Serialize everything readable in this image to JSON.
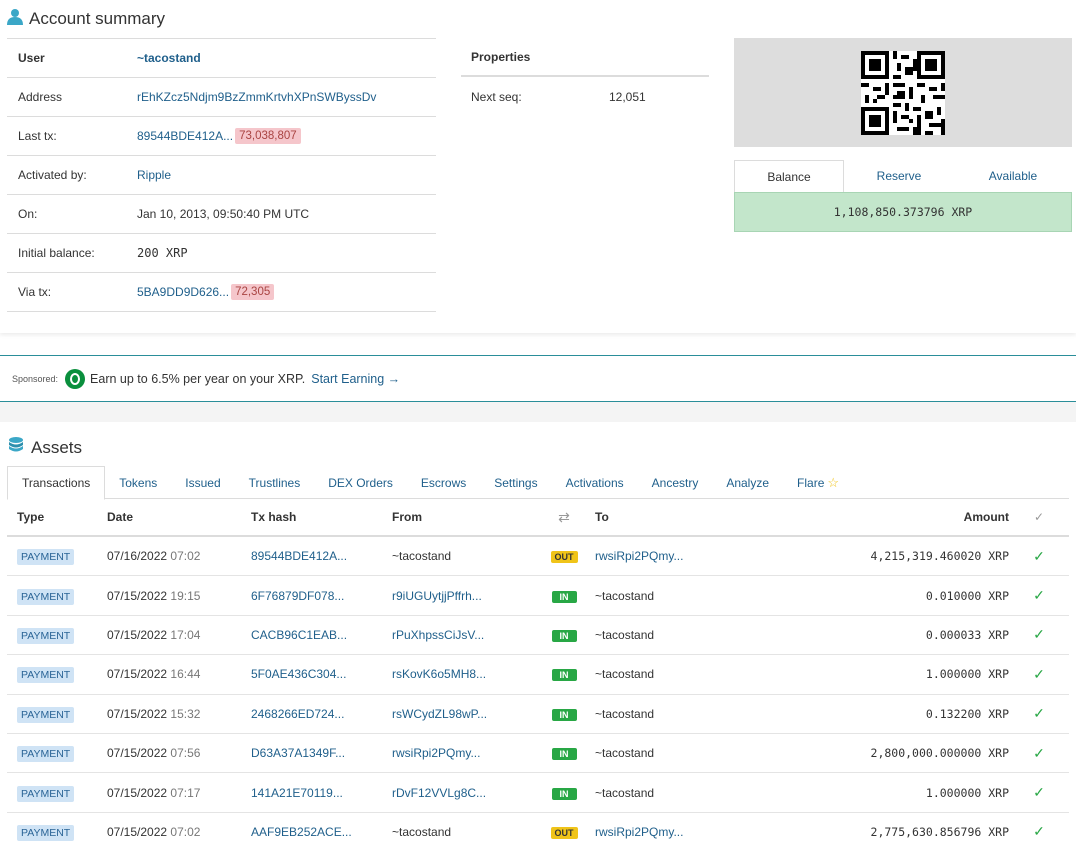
{
  "summary": {
    "title": "Account summary",
    "user_label": "User",
    "user_value": "~tacostand",
    "rows": [
      {
        "label": "Address",
        "value": "rEhKZcz5Ndjm9BzZmmKrtvhXPnSWByssDv",
        "badge": ""
      },
      {
        "label": "Last tx:",
        "value": "89544BDE412A...",
        "badge": "73,038,807"
      },
      {
        "label": "Activated by:",
        "value": "Ripple",
        "badge": ""
      },
      {
        "label": "On:",
        "value": "Jan 10, 2013, 09:50:40 PM UTC",
        "badge": ""
      },
      {
        "label": "Initial balance:",
        "value": "200 XRP",
        "badge": ""
      },
      {
        "label": "Via tx:",
        "value": "5BA9DD9D626...",
        "badge": "72,305"
      }
    ],
    "properties": {
      "header": "Properties",
      "next_seq_label": "Next seq:",
      "next_seq_value": "12,051"
    },
    "balance_tabs": [
      "Balance",
      "Reserve",
      "Available"
    ],
    "balance_value": "1,108,850.373796 XRP"
  },
  "sponsored": {
    "label": "Sponsored:",
    "message": "Earn up to 6.5% per year on your XRP.",
    "cta": "Start Earning →"
  },
  "assets": {
    "title": "Assets",
    "tabs": [
      "Transactions",
      "Tokens",
      "Issued",
      "Trustlines",
      "DEX Orders",
      "Escrows",
      "Settings",
      "Activations",
      "Ancestry",
      "Analyze",
      "Flare"
    ],
    "columns": {
      "type": "Type",
      "date": "Date",
      "hash": "Tx hash",
      "from": "From",
      "to": "To",
      "amount": "Amount"
    },
    "rows": [
      {
        "type": "PAYMENT",
        "date": "07/16/2022",
        "time": "07:02",
        "hash": "89544BDE412A...",
        "from": "~tacostand",
        "dir": "OUT",
        "to": "rwsiRpi2PQmy...",
        "amount": "4,215,319.460020 XRP"
      },
      {
        "type": "PAYMENT",
        "date": "07/15/2022",
        "time": "19:15",
        "hash": "6F76879DF078...",
        "from": "r9iUGUytjjPffrh...",
        "dir": "IN",
        "to": "~tacostand",
        "amount": "0.010000 XRP"
      },
      {
        "type": "PAYMENT",
        "date": "07/15/2022",
        "time": "17:04",
        "hash": "CACB96C1EAB...",
        "from": "rPuXhpssCiJsV...",
        "dir": "IN",
        "to": "~tacostand",
        "amount": "0.000033 XRP"
      },
      {
        "type": "PAYMENT",
        "date": "07/15/2022",
        "time": "16:44",
        "hash": "5F0AE436C304...",
        "from": "rsKovK6o5MH8...",
        "dir": "IN",
        "to": "~tacostand",
        "amount": "1.000000 XRP"
      },
      {
        "type": "PAYMENT",
        "date": "07/15/2022",
        "time": "15:32",
        "hash": "2468266ED724...",
        "from": "rsWCydZL98wP...",
        "dir": "IN",
        "to": "~tacostand",
        "amount": "0.132200 XRP"
      },
      {
        "type": "PAYMENT",
        "date": "07/15/2022",
        "time": "07:56",
        "hash": "D63A37A1349F...",
        "from": "rwsiRpi2PQmy...",
        "dir": "IN",
        "to": "~tacostand",
        "amount": "2,800,000.000000 XRP"
      },
      {
        "type": "PAYMENT",
        "date": "07/15/2022",
        "time": "07:17",
        "hash": "141A21E70119...",
        "from": "rDvF12VVLg8C...",
        "dir": "IN",
        "to": "~tacostand",
        "amount": "1.000000 XRP"
      },
      {
        "type": "PAYMENT",
        "date": "07/15/2022",
        "time": "07:02",
        "hash": "AAF9EB252ACE...",
        "from": "~tacostand",
        "dir": "OUT",
        "to": "rwsiRpi2PQmy...",
        "amount": "2,775,630.856796 XRP"
      }
    ]
  }
}
